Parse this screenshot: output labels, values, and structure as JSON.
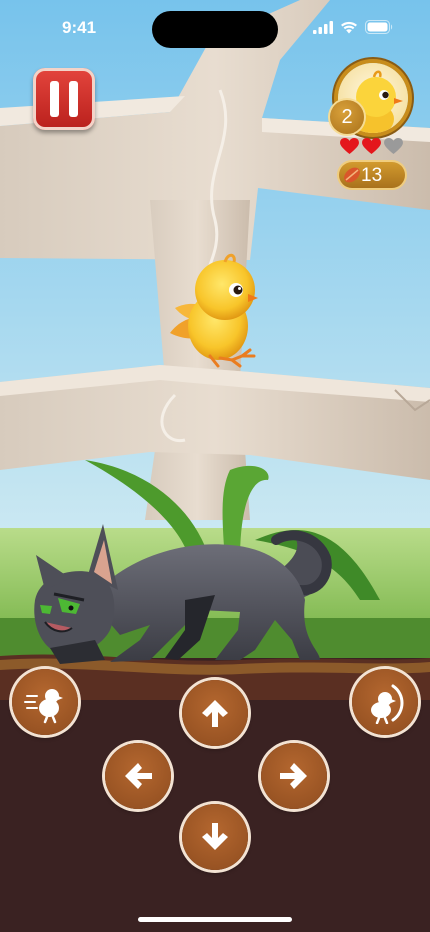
{
  "status_bar": {
    "time": "9:41",
    "icons": [
      "signal-icon",
      "wifi-icon",
      "battery-icon"
    ]
  },
  "hud": {
    "pause_icon": "pause-icon",
    "player_level": "2",
    "lives": {
      "filled": 2,
      "total": 3
    },
    "seeds": "13",
    "colors": {
      "pause": "#d0302a",
      "heart_full": "#e4161c",
      "heart_empty": "#9a9a9a",
      "badge": "#b47a1e"
    }
  },
  "scene": {
    "characters": [
      "yellow-chick",
      "gray-cat"
    ],
    "elements": [
      "tree",
      "grass",
      "ground"
    ]
  },
  "controls": {
    "buttons": [
      {
        "action": "dash",
        "icon": "chick-dash-icon"
      },
      {
        "action": "up",
        "icon": "arrow-up-icon"
      },
      {
        "action": "flap",
        "icon": "chick-flap-icon"
      },
      {
        "action": "left",
        "icon": "arrow-left-icon"
      },
      {
        "action": "right",
        "icon": "arrow-right-icon"
      },
      {
        "action": "down",
        "icon": "arrow-down-icon"
      }
    ],
    "color": "#9e5525"
  }
}
